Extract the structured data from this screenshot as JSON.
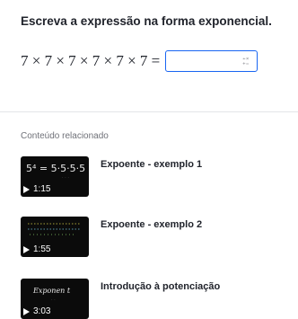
{
  "question": {
    "prompt": "Escreva a expressão na forma exponencial.",
    "expression": "7 × 7 × 7 × 7 × 7 × 7 =",
    "answer_value": "",
    "keypad_icon": "keypad-toggle-icon"
  },
  "related": {
    "title": "Conteúdo relacionado",
    "videos": [
      {
        "title": "Expoente - exemplo 1",
        "duration": "1:15",
        "thumbnail_text": "5⁴ = 5·5·5·5"
      },
      {
        "title": "Expoente - exemplo 2",
        "duration": "1:55",
        "thumbnail_text": ""
      },
      {
        "title": "Introdução à potenciação",
        "duration": "3:03",
        "thumbnail_text": "Exponen t"
      }
    ]
  },
  "colors": {
    "accent": "#1865f2",
    "text": "#21242c",
    "muted": "#6f7178",
    "divider": "#e3e5e8",
    "thumbnail_bg": "#0b0b0b"
  }
}
